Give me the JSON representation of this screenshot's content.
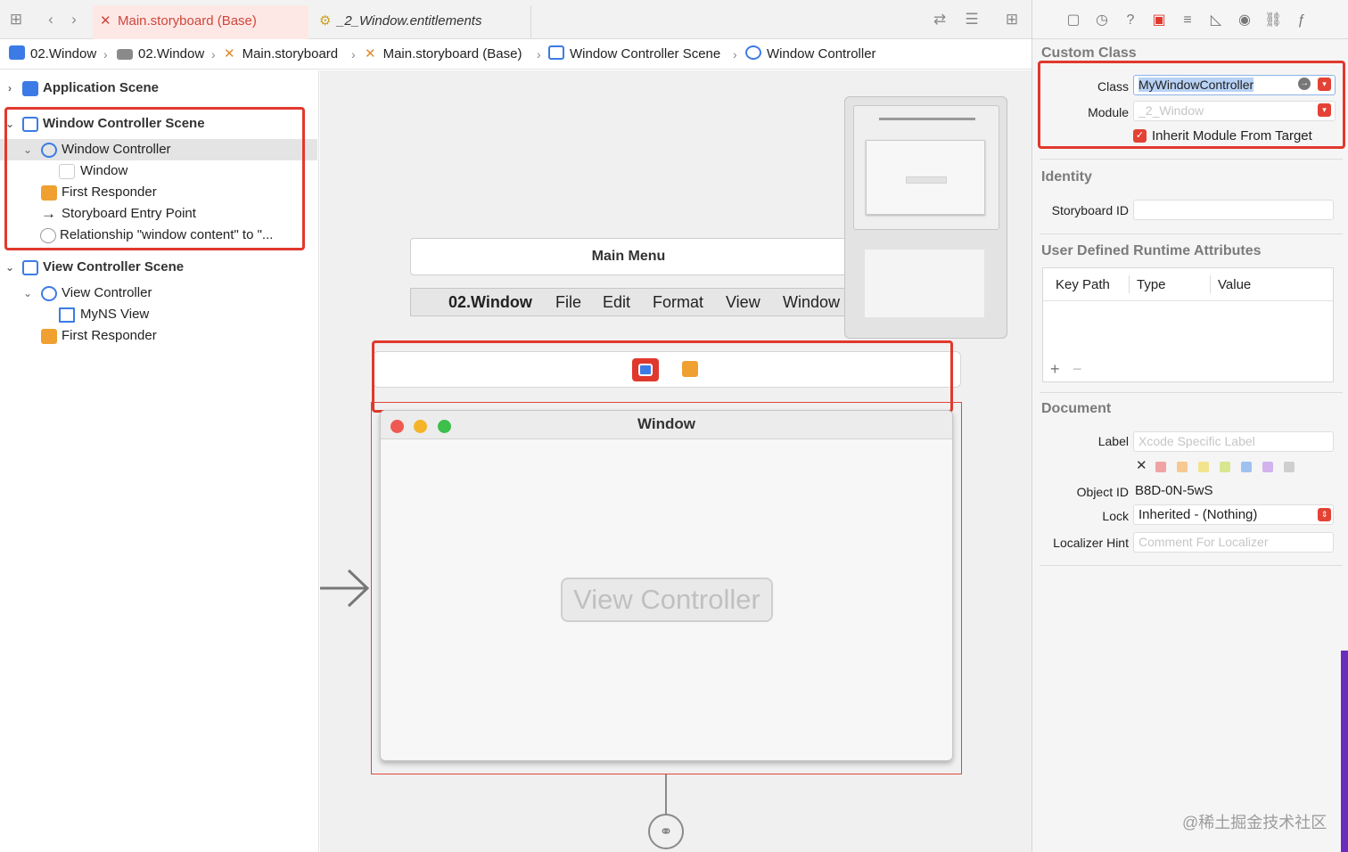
{
  "tabs": {
    "active": "Main.storyboard (Base)",
    "second": "_2_Window.entitlements"
  },
  "breadcrumb": {
    "items": [
      "02.Window",
      "02.Window",
      "Main.storyboard",
      "Main.storyboard (Base)",
      "Window Controller Scene",
      "Window Controller"
    ]
  },
  "outline": {
    "items": [
      {
        "label": "Application Scene"
      },
      {
        "label": "Window Controller Scene"
      },
      {
        "label": "Window Controller"
      },
      {
        "label": "Window"
      },
      {
        "label": "First Responder"
      },
      {
        "label": "Storyboard Entry Point"
      },
      {
        "label": "Relationship \"window content\" to \"..."
      },
      {
        "label": "View Controller Scene"
      },
      {
        "label": "View Controller"
      },
      {
        "label": "MyNS View"
      },
      {
        "label": "First Responder"
      }
    ]
  },
  "canvas": {
    "main_menu": "Main Menu",
    "menu_items": [
      "02.Window",
      "File",
      "Edit",
      "Format",
      "View",
      "Window"
    ],
    "window_title": "Window",
    "view_controller_label": "View Controller"
  },
  "inspector": {
    "custom_class": {
      "title": "Custom Class",
      "class_label": "Class",
      "class_value": "MyWindowController",
      "module_label": "Module",
      "module_placeholder": "_2_Window",
      "inherit_label": "Inherit Module From Target"
    },
    "identity": {
      "title": "Identity",
      "storyboard_id_label": "Storyboard ID"
    },
    "runtime_attributes": {
      "title": "User Defined Runtime Attributes",
      "columns": [
        "Key Path",
        "Type",
        "Value"
      ],
      "add": "+",
      "remove": "−"
    },
    "document": {
      "title": "Document",
      "label_label": "Label",
      "label_placeholder": "Xcode Specific Label",
      "object_id_label": "Object ID",
      "object_id_value": "B8D-0N-5wS",
      "lock_label": "Lock",
      "lock_value": "Inherited - (Nothing)",
      "hint_label": "Localizer Hint",
      "hint_placeholder": "Comment For Localizer",
      "clear_color": "✕",
      "color_swatches": [
        "#f0a3a3",
        "#f5c98f",
        "#f2e48c",
        "#d8e68f",
        "#9fc1f0",
        "#d2b3ee",
        "#cfcfcf"
      ]
    }
  },
  "watermark": "@稀土掘金技术社区",
  "colors": {
    "accent_red": "#e1382d",
    "tab_active_text": "#d0463b",
    "storyboard_blue": "#3c7be6",
    "responder_orange": "#f0a030"
  }
}
